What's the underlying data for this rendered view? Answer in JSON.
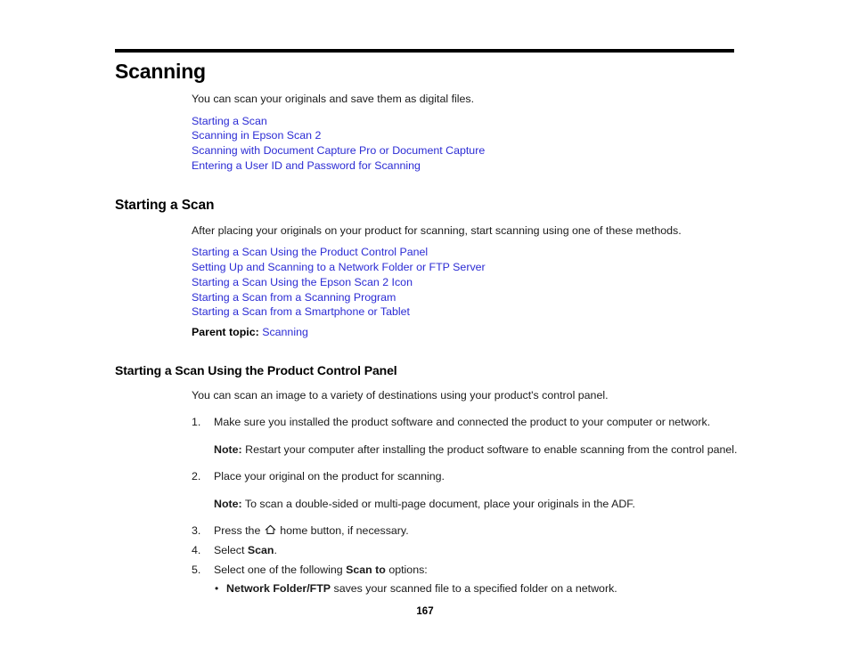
{
  "document": {
    "chapter_title": "Scanning",
    "intro": "You can scan your originals and save them as digital files.",
    "toc_links": [
      "Starting a Scan",
      "Scanning in Epson Scan 2",
      "Scanning with Document Capture Pro or Document Capture",
      "Entering a User ID and Password for Scanning"
    ],
    "section": {
      "title": "Starting a Scan",
      "intro": "After placing your originals on your product for scanning, start scanning using one of these methods.",
      "links": [
        "Starting a Scan Using the Product Control Panel",
        "Setting Up and Scanning to a Network Folder or FTP Server",
        "Starting a Scan Using the Epson Scan 2 Icon",
        "Starting a Scan from a Scanning Program",
        "Starting a Scan from a Smartphone or Tablet"
      ],
      "parent_topic_label": "Parent topic:",
      "parent_topic_link": "Scanning"
    },
    "subsection": {
      "title": "Starting a Scan Using the Product Control Panel",
      "intro": "You can scan an image to a variety of destinations using your product's control panel.",
      "steps": [
        {
          "number": "1.",
          "text": "Make sure you installed the product software and connected the product to your computer or network.",
          "note_label": "Note:",
          "note_text": "Restart your computer after installing the product software to enable scanning from the control panel."
        },
        {
          "number": "2.",
          "text": "Place your original on the product for scanning.",
          "note_label": "Note:",
          "note_text": "To scan a double-sided or multi-page document, place your originals in the ADF."
        },
        {
          "number": "3.",
          "text_before_icon": "Press the",
          "icon": "home-icon",
          "text_after_icon": "home button, if necessary."
        },
        {
          "number": "4.",
          "text_before_bold": "Select",
          "bold": "Scan",
          "text_after_bold": "."
        },
        {
          "number": "5.",
          "text_before_bold": "Select one of the following",
          "bold": "Scan to",
          "text_after_bold": "options:",
          "bullets": [
            {
              "bold": "Network Folder/FTP",
              "text": "saves your scanned file to a specified folder on a network."
            }
          ]
        }
      ]
    },
    "page_number": "167",
    "colors": {
      "link": "#2b2bd4",
      "text": "#1a1a1a",
      "rule": "#000000",
      "background": "#ffffff"
    }
  }
}
